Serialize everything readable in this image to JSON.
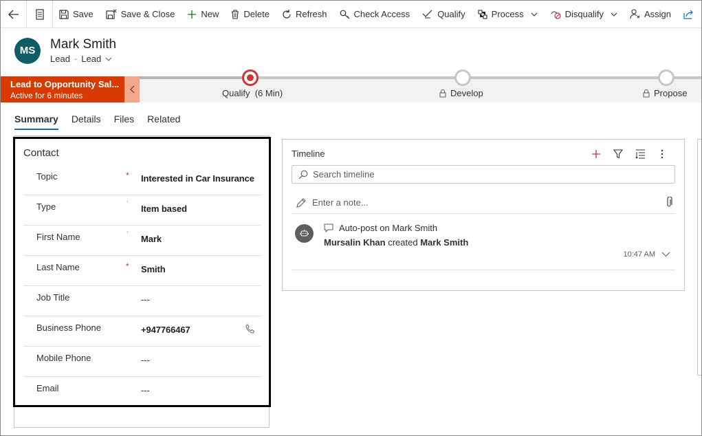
{
  "commands": [
    {
      "id": "save",
      "label": "Save",
      "icon": "save-icon"
    },
    {
      "id": "save-close",
      "label": "Save & Close",
      "icon": "save-close-icon"
    },
    {
      "id": "new",
      "label": "New",
      "icon": "plus-icon"
    },
    {
      "id": "delete",
      "label": "Delete",
      "icon": "trash-icon"
    },
    {
      "id": "refresh",
      "label": "Refresh",
      "icon": "refresh-icon"
    },
    {
      "id": "check-access",
      "label": "Check Access",
      "icon": "key-icon"
    },
    {
      "id": "qualify",
      "label": "Qualify",
      "icon": "qualify-icon"
    },
    {
      "id": "process",
      "label": "Process",
      "icon": "process-icon"
    },
    {
      "id": "disqualify",
      "label": "Disqualify",
      "icon": "disqualify-icon"
    },
    {
      "id": "assign",
      "label": "Assign",
      "icon": "person-icon"
    }
  ],
  "header": {
    "initials": "MS",
    "name": "Mark Smith",
    "entity": "Lead",
    "form": "Lead",
    "avatar_color": "#0e5d66"
  },
  "bpf": {
    "title": "Lead to Opportunity Sal...",
    "duration": "Active for 6 minutes",
    "stages": [
      {
        "label": "Qualify",
        "time": "(6 Min)",
        "active": true
      },
      {
        "label": "Develop",
        "time": "",
        "active": false
      },
      {
        "label": "Propose",
        "time": "",
        "active": false
      }
    ],
    "accent": "#d83b01"
  },
  "tabs": [
    "Summary",
    "Details",
    "Files",
    "Related"
  ],
  "contact": {
    "title": "Contact",
    "fields": [
      {
        "label": "Topic",
        "value": "Interested in Car Insurance",
        "req": "required"
      },
      {
        "label": "Type",
        "value": "Item based",
        "req": "recommended"
      },
      {
        "label": "First Name",
        "value": "Mark",
        "req": "recommended"
      },
      {
        "label": "Last Name",
        "value": "Smith",
        "req": "required"
      },
      {
        "label": "Job Title",
        "value": "---",
        "req": ""
      },
      {
        "label": "Business Phone",
        "value": "+947766467",
        "req": "",
        "icon": "phone-icon"
      },
      {
        "label": "Mobile Phone",
        "value": "---",
        "req": ""
      },
      {
        "label": "Email",
        "value": "---",
        "req": ""
      }
    ],
    "required_mark": "*",
    "recommended_mark": "˙"
  },
  "timeline": {
    "title": "Timeline",
    "search_placeholder": "Search timeline",
    "note_placeholder": "Enter a note...",
    "items": [
      {
        "title": "Auto-post on Mark Smith",
        "actor": "Mursalin Khan",
        "verb": "created",
        "target": "Mark Smith",
        "time": "10:47 AM"
      }
    ]
  }
}
